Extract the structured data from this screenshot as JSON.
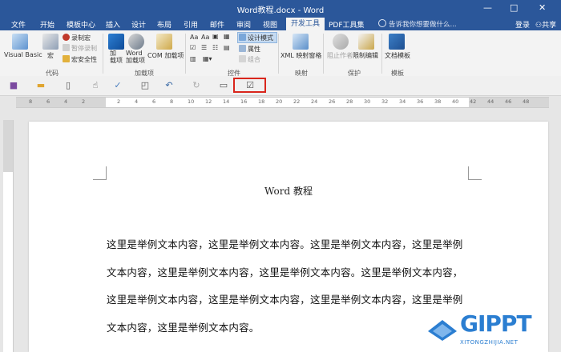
{
  "window": {
    "title": "Word教程.docx - Word",
    "controls": [
      "—",
      "□",
      "✕"
    ]
  },
  "tabs": [
    "文件",
    "开始",
    "模板中心",
    "插入",
    "设计",
    "布局",
    "引用",
    "邮件",
    "审阅",
    "视图",
    "开发工具",
    "PDF工具集"
  ],
  "active_tab": "开发工具",
  "tellme": "告诉我你想要做什么...",
  "account": {
    "login": "登录",
    "share": "共享"
  },
  "ribbon": {
    "code": {
      "label": "代码",
      "visual_basic": "Visual Basic",
      "macros": "宏",
      "record_macro": "录制宏",
      "pause_recording": "暂停录制",
      "macro_security": "宏安全性"
    },
    "addins": {
      "label": "加载项",
      "addins": "加\n载项",
      "word_addins": "Word\n加载项",
      "com_addins": "COM 加载项"
    },
    "controls": {
      "label": "控件",
      "design_mode": "设计模式",
      "properties": "属性",
      "group": "组合"
    },
    "mapping": {
      "label": "映射",
      "xml_pane": "XML 映射窗格"
    },
    "protect": {
      "label": "保护",
      "block_authors": "阻止作者",
      "restrict_editing": "限制编辑"
    },
    "templates": {
      "label": "模板",
      "document_template": "文档模板"
    }
  },
  "qat_icons": [
    "save-icon",
    "open-icon",
    "new-icon",
    "touch-mode-icon",
    "spelling-icon",
    "print-preview-icon",
    "undo-icon",
    "redo-icon",
    "print-layout-icon",
    "design-mode-icon"
  ],
  "ruler": {
    "numbers": [
      "8",
      "6",
      "4",
      "2",
      "",
      "2",
      "4",
      "6",
      "8",
      "10",
      "12",
      "14",
      "16",
      "18",
      "20",
      "22",
      "24",
      "26",
      "28",
      "30",
      "32",
      "34",
      "36",
      "38",
      "40",
      "42",
      "44",
      "46",
      "48"
    ]
  },
  "document": {
    "title": "Word 教程",
    "lines": [
      "这里是举例文本内容，这里是举例文本内容。这里是举例文本内容，这里是举例",
      "文本内容，这里是举例文本内容，这里是举例文本内容。这里是举例文本内容，",
      "这里是举例文本内容，这里是举例文本内容，这里是举例文本内容，这里是举例",
      "文本内容，这里是举例文本内容。"
    ]
  },
  "watermark": {
    "brand": "GIPPT",
    "url": "XITONGZHIJIA.NET"
  }
}
